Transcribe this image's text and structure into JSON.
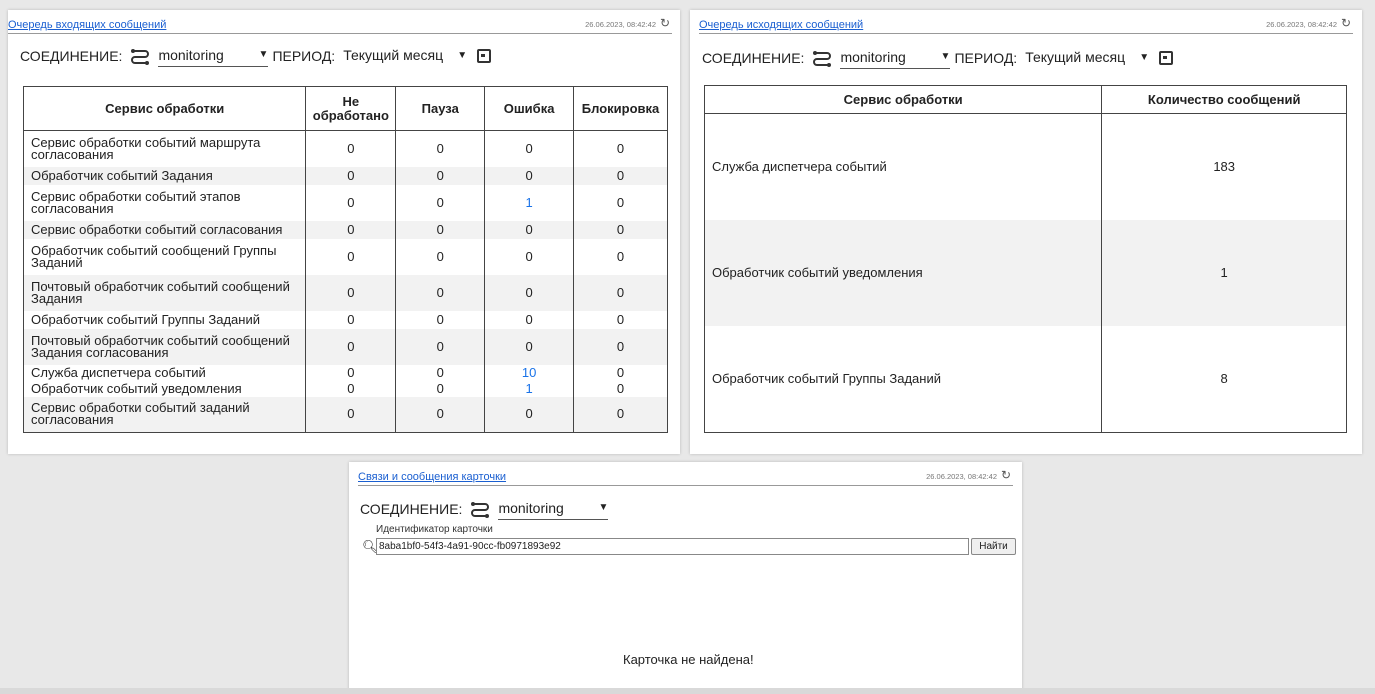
{
  "incoming": {
    "title": "Очередь входящих сообщений",
    "timestamp": "26.06.2023, 08:42:42",
    "connection_label": "СОЕДИНЕНИЕ:",
    "connection_value": "monitoring",
    "period_label": "ПЕРИОД:",
    "period_value": "Текущий месяц",
    "columns": [
      "Сервис обработки",
      "Не обработано",
      "Пауза",
      "Ошибка",
      "Блокировка"
    ],
    "rows": [
      {
        "service": "Сервис обработки событий маршрута согласования",
        "unprocessed": "0",
        "pause": "0",
        "error": "0",
        "block": "0"
      },
      {
        "service": "Обработчик событий Задания",
        "unprocessed": "0",
        "pause": "0",
        "error": "0",
        "block": "0"
      },
      {
        "service": "Сервис обработки событий этапов согласования",
        "unprocessed": "0",
        "pause": "0",
        "error": "1",
        "block": "0"
      },
      {
        "service": "Сервис обработки событий согласования",
        "unprocessed": "0",
        "pause": "0",
        "error": "0",
        "block": "0"
      },
      {
        "service": "Обработчик событий сообщений Группы Заданий",
        "unprocessed": "0",
        "pause": "0",
        "error": "0",
        "block": "0"
      },
      {
        "service": "Почтовый обработчик событий сообщений Задания",
        "unprocessed": "0",
        "pause": "0",
        "error": "0",
        "block": "0"
      },
      {
        "service": "Обработчик событий Группы Заданий",
        "unprocessed": "0",
        "pause": "0",
        "error": "0",
        "block": "0"
      },
      {
        "service": "Почтовый обработчик событий сообщений Задания согласования",
        "unprocessed": "0",
        "pause": "0",
        "error": "0",
        "block": "0"
      },
      {
        "service": "Служба диспетчера событий",
        "unprocessed": "0",
        "pause": "0",
        "error": "10",
        "block": "0"
      },
      {
        "service": "Обработчик событий уведомления",
        "unprocessed": "0",
        "pause": "0",
        "error": "1",
        "block": "0"
      },
      {
        "service": "Сервис обработки событий заданий согласования",
        "unprocessed": "0",
        "pause": "0",
        "error": "0",
        "block": "0"
      }
    ]
  },
  "outgoing": {
    "title": "Очередь исходящих сообщений",
    "timestamp": "26.06.2023, 08:42:42",
    "connection_label": "СОЕДИНЕНИЕ:",
    "connection_value": "monitoring",
    "period_label": "ПЕРИОД:",
    "period_value": "Текущий месяц",
    "columns": [
      "Сервис обработки",
      "Количество сообщений"
    ],
    "rows": [
      {
        "service": "Служба диспетчера событий",
        "count": "183"
      },
      {
        "service": "Обработчик событий уведомления",
        "count": "1"
      },
      {
        "service": "Обработчик событий Группы Заданий",
        "count": "8"
      }
    ]
  },
  "card": {
    "title": "Связи и сообщения карточки",
    "timestamp": "26.06.2023, 08:42:42",
    "connection_label": "СОЕДИНЕНИЕ:",
    "connection_value": "monitoring",
    "search_label": "Идентификатор карточки",
    "search_value": "8aba1bf0-54f3-4a91-90cc-fb0971893e92",
    "find_button": "Найти",
    "empty_message": "Карточка не найдена!"
  },
  "icons": {
    "refresh": "refresh-icon",
    "connection": "connection-icon",
    "calendar": "calendar-icon",
    "search": "search-icon",
    "chevron": "chevron-down-icon"
  },
  "colors": {
    "link": "#1a5fd1",
    "error_value": "#1a73e8",
    "row_alt": "#f2f2f2"
  }
}
